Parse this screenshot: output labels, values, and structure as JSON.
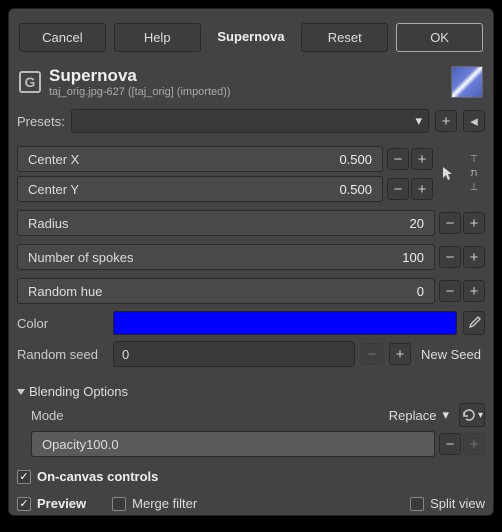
{
  "buttons": {
    "cancel": "Cancel",
    "help": "Help",
    "title": "Supernova",
    "reset": "Reset",
    "ok": "OK"
  },
  "header": {
    "title": "Supernova",
    "subtitle": "taj_orig.jpg-627 ([taj_orig] (imported))"
  },
  "presets": {
    "label": "Presets:"
  },
  "fields": {
    "center_x": {
      "label": "Center X",
      "value": "0.500"
    },
    "center_y": {
      "label": "Center Y",
      "value": "0.500"
    },
    "radius": {
      "label": "Radius",
      "value": "20"
    },
    "spokes": {
      "label": "Number of spokes",
      "value": "100"
    },
    "random_hue": {
      "label": "Random hue",
      "value": "0"
    }
  },
  "color": {
    "label": "Color",
    "value": "#0000ff"
  },
  "seed": {
    "label": "Random seed",
    "value": "0",
    "new": "New Seed"
  },
  "blending": {
    "title": "Blending Options",
    "mode_label": "Mode",
    "mode_value": "Replace",
    "opacity_label": "Opacity",
    "opacity_value": "100.0"
  },
  "checks": {
    "on_canvas": "On-canvas controls",
    "preview": "Preview",
    "merge": "Merge filter",
    "split": "Split view"
  },
  "icons": {
    "plus": "+",
    "minus": "−",
    "tri_down": "▾",
    "tri_left": "◂"
  }
}
